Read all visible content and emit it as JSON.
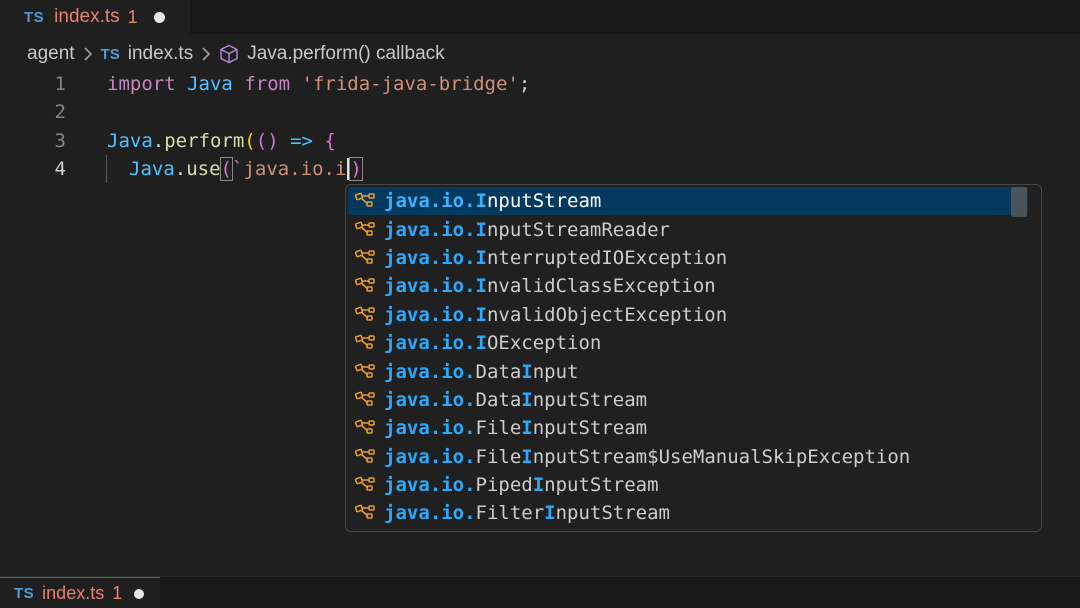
{
  "tab": {
    "lang": "TS",
    "filename": "index.ts",
    "problems": "1"
  },
  "breadcrumb": {
    "folder": "agent",
    "file_lang": "TS",
    "file": "index.ts",
    "symbol": "Java.perform() callback"
  },
  "editor": {
    "line_numbers": [
      "1",
      "2",
      "3",
      "4"
    ],
    "line1": {
      "kw_import": "import",
      "ident": "Java",
      "kw_from": "from",
      "string": "'frida-java-bridge'",
      "semi": ";"
    },
    "line3": {
      "obj": "Java",
      "dot": ".",
      "method": "perform",
      "open": "(",
      "params": "()",
      "arrow": " => ",
      "brace": "{"
    },
    "line4": {
      "obj": "Java",
      "dot": ".",
      "method": "use",
      "open": "(",
      "typed": "`java.io.i",
      "close": ")"
    }
  },
  "suggestions": {
    "prefix": "java.io.",
    "selected_index": 0,
    "items": [
      {
        "pre": "",
        "hl": "I",
        "post": "nputStream"
      },
      {
        "pre": "",
        "hl": "I",
        "post": "nputStreamReader"
      },
      {
        "pre": "",
        "hl": "I",
        "post": "nterruptedIOException"
      },
      {
        "pre": "",
        "hl": "I",
        "post": "nvalidClassException"
      },
      {
        "pre": "",
        "hl": "I",
        "post": "nvalidObjectException"
      },
      {
        "pre": "",
        "hl": "I",
        "post": "OException"
      },
      {
        "pre": "Data",
        "hl": "I",
        "post": "nput"
      },
      {
        "pre": "Data",
        "hl": "I",
        "post": "nputStream"
      },
      {
        "pre": "File",
        "hl": "I",
        "post": "nputStream"
      },
      {
        "pre": "File",
        "hl": "I",
        "post": "nputStream$UseManualSkipException"
      },
      {
        "pre": "Piped",
        "hl": "I",
        "post": "nputStream"
      },
      {
        "pre": "Filter",
        "hl": "I",
        "post": "nputStream"
      }
    ]
  },
  "bottom_tab": {
    "lang": "TS",
    "filename": "index.ts",
    "problems": "1"
  },
  "colors": {
    "accent": "#0078d4",
    "selection": "#04395e",
    "match_highlight": "#2aaaff",
    "tab_error": "#e8816e"
  },
  "icons": {
    "suggestion_kind": "class-icon",
    "breadcrumb_symbol": "cube-icon"
  }
}
